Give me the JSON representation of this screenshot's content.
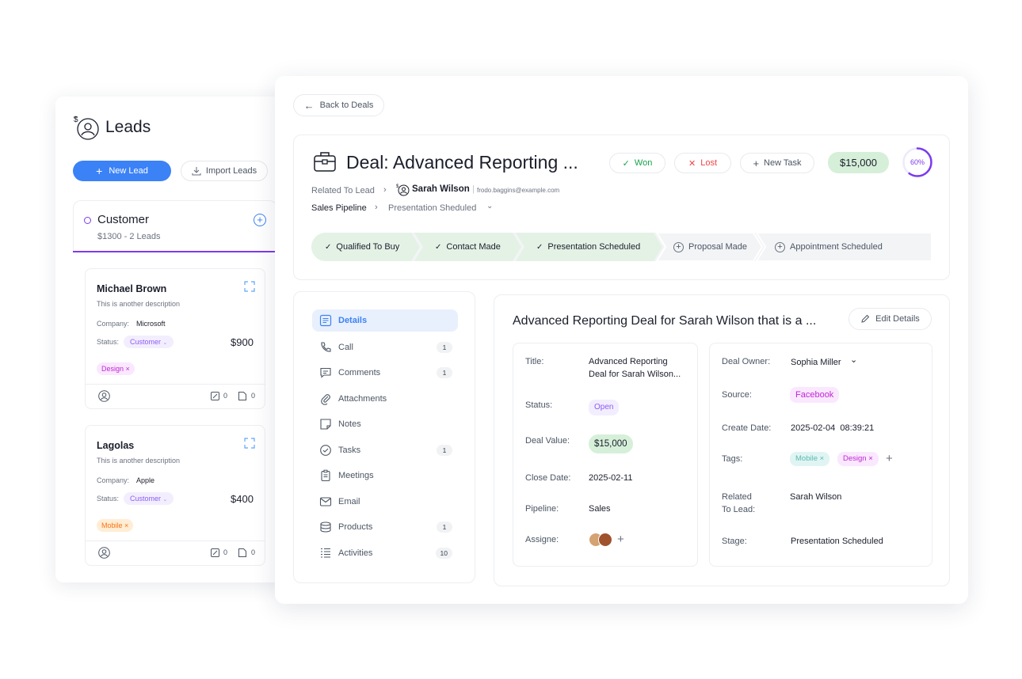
{
  "leads_panel": {
    "title": "Leads",
    "new_lead_label": "New Lead",
    "import_label": "Import Leads",
    "group": {
      "name": "Customer",
      "summary": "$1300 - 2 Leads"
    },
    "cards": [
      {
        "name": "Michael Brown",
        "description": "This is another description",
        "company_label": "Company:",
        "company": "Microsoft",
        "status_label": "Status:",
        "status": "Customer",
        "amount": "$900",
        "tag": "Design",
        "tag_color": "#c026d3",
        "comments": "0",
        "files": "0"
      },
      {
        "name": "Lagolas",
        "description": "This is another description",
        "company_label": "Company:",
        "company": "Apple",
        "status_label": "Status:",
        "status": "Customer",
        "amount": "$400",
        "tag": "Mobile",
        "tag_color": "#f97316",
        "comments": "0",
        "files": "0"
      }
    ]
  },
  "deal": {
    "back_label": "Back to Deals",
    "title": "Deal: Advanced Reporting ...",
    "actions": {
      "won": "Won",
      "lost": "Lost",
      "new_task": "New Task"
    },
    "amount": "$15,000",
    "progress_percent": 60,
    "progress_label": "60%",
    "related_label": "Related To Lead",
    "related_name": "Sarah Wilson",
    "related_email": "frodo.baggins@example.com",
    "pipeline_label": "Sales Pipeline",
    "pipeline_stage": "Presentation Sheduled",
    "stages": [
      {
        "label": "Qualified To Buy",
        "done": true
      },
      {
        "label": "Contact Made",
        "done": true
      },
      {
        "label": "Presentation Scheduled",
        "done": true
      },
      {
        "label": "Proposal Made",
        "done": false
      },
      {
        "label": "Appointment Scheduled",
        "done": false
      }
    ],
    "nav": [
      {
        "label": "Details",
        "icon": "details-icon",
        "count": ""
      },
      {
        "label": "Call",
        "icon": "phone-icon",
        "count": "1"
      },
      {
        "label": "Comments",
        "icon": "comment-icon",
        "count": "1"
      },
      {
        "label": "Attachments",
        "icon": "paperclip-icon",
        "count": ""
      },
      {
        "label": "Notes",
        "icon": "note-icon",
        "count": ""
      },
      {
        "label": "Tasks",
        "icon": "tasks-icon",
        "count": "1"
      },
      {
        "label": "Meetings",
        "icon": "clipboard-icon",
        "count": ""
      },
      {
        "label": "Email",
        "icon": "mail-icon",
        "count": ""
      },
      {
        "label": "Products",
        "icon": "stack-icon",
        "count": "1"
      },
      {
        "label": "Activities",
        "icon": "list-icon",
        "count": "10"
      }
    ],
    "details": {
      "heading": "Advanced Reporting Deal for Sarah Wilson that is a ...",
      "edit_label": "Edit Details",
      "left": {
        "title_label": "Title:",
        "title_line1": "Advanced Reporting",
        "title_line2": "Deal for Sarah Wilson...",
        "status_label": "Status:",
        "status": "Open",
        "value_label": "Deal Value:",
        "value": "$15,000",
        "close_label": "Close Date:",
        "close": "2025-02-11",
        "pipeline_label": "Pipeline:",
        "pipeline": "Sales",
        "assignee_label": "Assigne:"
      },
      "right": {
        "owner_label": "Deal Owner:",
        "owner": "Sophia Miller",
        "source_label": "Source:",
        "source": "Facebook",
        "create_label": "Create Date:",
        "create": "2025-02-04  08:39:21",
        "tags_label": "Tags:",
        "tags": [
          "Mobile",
          "Design"
        ],
        "related_label_1": "Related",
        "related_label_2": "To Lead:",
        "related": "Sarah Wilson",
        "stage_label": "Stage:",
        "stage": "Presentation Scheduled"
      }
    }
  },
  "colors": {
    "primary": "#3b82f6",
    "purple": "#7c3aed",
    "green_done": "#e4f2e6",
    "green_amount": "#d6efd9",
    "won": "#16a34a",
    "lost": "#ef4444"
  }
}
